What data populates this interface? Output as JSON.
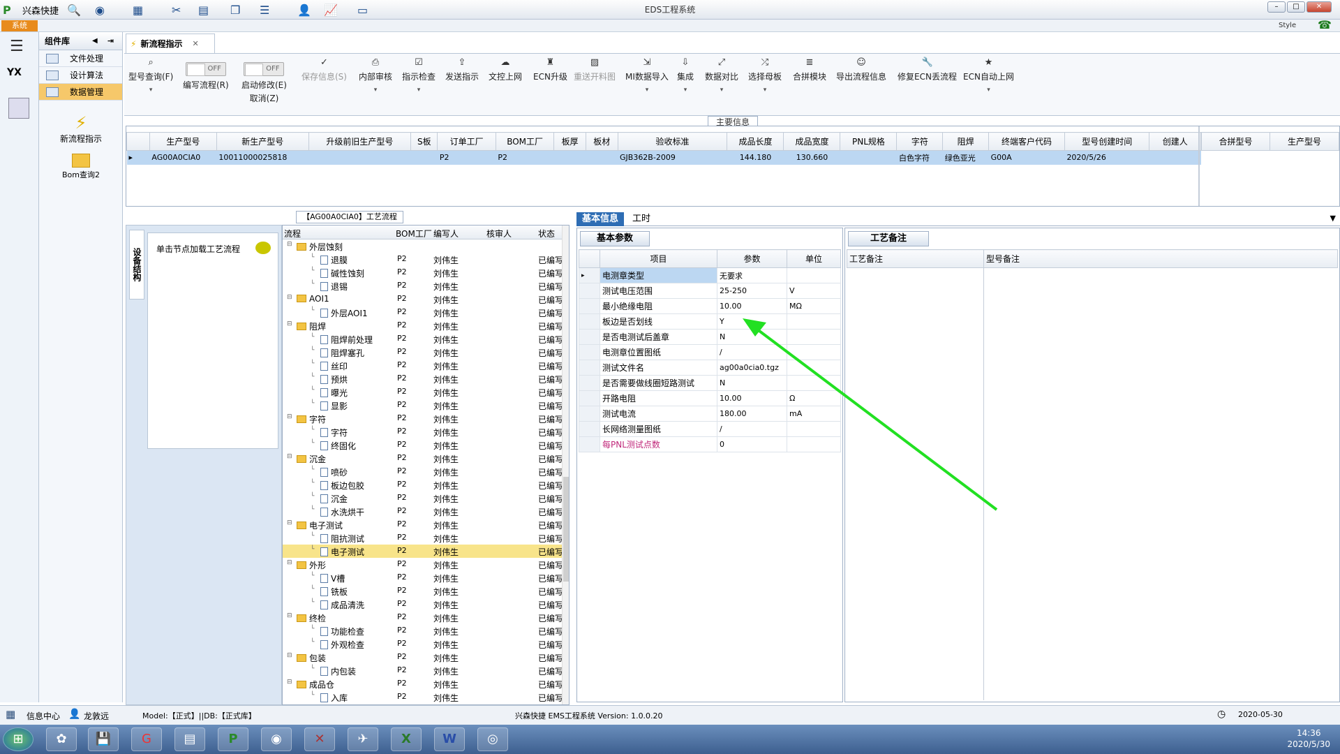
{
  "titlebar": {
    "app_name": "兴森快捷",
    "title": "EDS工程系统"
  },
  "system_tab": "系统",
  "style_label": "Style",
  "nav": {
    "header": "组件库",
    "items": [
      {
        "label": "文件处理"
      },
      {
        "label": "设计算法"
      },
      {
        "label": "数据管理"
      }
    ],
    "big_items": [
      {
        "label": "新流程指示"
      },
      {
        "label": "Bom查询2"
      }
    ]
  },
  "doc_tab": "新流程指示",
  "ribbon": {
    "buttons": [
      {
        "label": "型号查询(F)"
      },
      {
        "label": "编写流程(R)",
        "toggle": "OFF"
      },
      {
        "label": "启动修改(E)",
        "label2": "取消(Z)",
        "toggle": "OFF"
      },
      {
        "label": "保存信息(S)"
      },
      {
        "label": "内部审核"
      },
      {
        "label": "指示检查"
      },
      {
        "label": "发送指示"
      },
      {
        "label": "文控上网"
      },
      {
        "label": "ECN升级"
      },
      {
        "label": "重送开料图"
      },
      {
        "label": "MI数据导入"
      },
      {
        "label": "集成"
      },
      {
        "label": "数据对比"
      },
      {
        "label": "选择母板"
      },
      {
        "label": "合拼模块"
      },
      {
        "label": "导出流程信息"
      },
      {
        "label": "修复ECN丢流程"
      },
      {
        "label": "ECN自动上网"
      }
    ]
  },
  "main_info": {
    "label": "主要信息",
    "columns": [
      "生产型号",
      "新生产型号",
      "升级前旧生产型号",
      "S板",
      "订单工厂",
      "BOM工厂",
      "板厚",
      "板材",
      "验收标准",
      "成品长度",
      "成品宽度",
      "PNL规格",
      "字符",
      "阻焊",
      "终端客户代码",
      "型号创建时间",
      "创建人"
    ],
    "row": [
      "AG00A0CIA0",
      "10011000025818",
      "",
      "",
      "P2",
      "P2",
      "",
      "",
      "GJB362B-2009",
      "144.180",
      "130.660",
      "",
      "白色字符",
      "绿色亚光",
      "G00A",
      "2020/5/26",
      ""
    ],
    "side_columns": [
      "合拼型号",
      "生产型号"
    ]
  },
  "struct": {
    "tab": "设备结构",
    "hint": "单击节点加载工艺流程"
  },
  "flow": {
    "title": "【AG00A0CIA0】工艺流程",
    "columns": [
      "流程",
      "BOM工厂",
      "编写人",
      "核审人",
      "状态"
    ],
    "rows": [
      {
        "name": "外层蚀刻",
        "level": 0,
        "bom": "",
        "writer": "",
        "status": ""
      },
      {
        "name": "退膜",
        "level": 1,
        "bom": "P2",
        "writer": "刘伟生",
        "status": "已编写"
      },
      {
        "name": "碱性蚀刻",
        "level": 1,
        "bom": "P2",
        "writer": "刘伟生",
        "status": "已编写"
      },
      {
        "name": "退锡",
        "level": 1,
        "bom": "P2",
        "writer": "刘伟生",
        "status": "已编写"
      },
      {
        "name": "AOI1",
        "level": 0,
        "bom": "P2",
        "writer": "刘伟生",
        "status": "已编写"
      },
      {
        "name": "外层AOI1",
        "level": 1,
        "bom": "P2",
        "writer": "刘伟生",
        "status": "已编写"
      },
      {
        "name": "阻焊",
        "level": 0,
        "bom": "P2",
        "writer": "刘伟生",
        "status": "已编写"
      },
      {
        "name": "阻焊前处理",
        "level": 1,
        "bom": "P2",
        "writer": "刘伟生",
        "status": "已编写"
      },
      {
        "name": "阻焊塞孔",
        "level": 1,
        "bom": "P2",
        "writer": "刘伟生",
        "status": "已编写"
      },
      {
        "name": "丝印",
        "level": 1,
        "bom": "P2",
        "writer": "刘伟生",
        "status": "已编写"
      },
      {
        "name": "预烘",
        "level": 1,
        "bom": "P2",
        "writer": "刘伟生",
        "status": "已编写"
      },
      {
        "name": "曝光",
        "level": 1,
        "bom": "P2",
        "writer": "刘伟生",
        "status": "已编写"
      },
      {
        "name": "显影",
        "level": 1,
        "bom": "P2",
        "writer": "刘伟生",
        "status": "已编写"
      },
      {
        "name": "字符",
        "level": 0,
        "bom": "P2",
        "writer": "刘伟生",
        "status": "已编写"
      },
      {
        "name": "字符",
        "level": 1,
        "bom": "P2",
        "writer": "刘伟生",
        "status": "已编写"
      },
      {
        "name": "终固化",
        "level": 1,
        "bom": "P2",
        "writer": "刘伟生",
        "status": "已编写"
      },
      {
        "name": "沉金",
        "level": 0,
        "bom": "P2",
        "writer": "刘伟生",
        "status": "已编写"
      },
      {
        "name": "喷砂",
        "level": 1,
        "bom": "P2",
        "writer": "刘伟生",
        "status": "已编写"
      },
      {
        "name": "板边包胶",
        "level": 1,
        "bom": "P2",
        "writer": "刘伟生",
        "status": "已编写"
      },
      {
        "name": "沉金",
        "level": 1,
        "bom": "P2",
        "writer": "刘伟生",
        "status": "已编写"
      },
      {
        "name": "水洗烘干",
        "level": 1,
        "bom": "P2",
        "writer": "刘伟生",
        "status": "已编写"
      },
      {
        "name": "电子测试",
        "level": 0,
        "bom": "P2",
        "writer": "刘伟生",
        "status": "已编写"
      },
      {
        "name": "阻抗测试",
        "level": 1,
        "bom": "P2",
        "writer": "刘伟生",
        "status": "已编写"
      },
      {
        "name": "电子测试",
        "level": 1,
        "bom": "P2",
        "writer": "刘伟生",
        "status": "已编写",
        "hl": true
      },
      {
        "name": "外形",
        "level": 0,
        "bom": "P2",
        "writer": "刘伟生",
        "status": "已编写"
      },
      {
        "name": "V槽",
        "level": 1,
        "bom": "P2",
        "writer": "刘伟生",
        "status": "已编写"
      },
      {
        "name": "铣板",
        "level": 1,
        "bom": "P2",
        "writer": "刘伟生",
        "status": "已编写"
      },
      {
        "name": "成品清洗",
        "level": 1,
        "bom": "P2",
        "writer": "刘伟生",
        "status": "已编写"
      },
      {
        "name": "终检",
        "level": 0,
        "bom": "P2",
        "writer": "刘伟生",
        "status": "已编写"
      },
      {
        "name": "功能检查",
        "level": 1,
        "bom": "P2",
        "writer": "刘伟生",
        "status": "已编写"
      },
      {
        "name": "外观检查",
        "level": 1,
        "bom": "P2",
        "writer": "刘伟生",
        "status": "已编写"
      },
      {
        "name": "包装",
        "level": 0,
        "bom": "P2",
        "writer": "刘伟生",
        "status": "已编写"
      },
      {
        "name": "内包装",
        "level": 1,
        "bom": "P2",
        "writer": "刘伟生",
        "status": "已编写"
      },
      {
        "name": "成品仓",
        "level": 0,
        "bom": "P2",
        "writer": "刘伟生",
        "status": "已编写"
      },
      {
        "name": "入库",
        "level": 1,
        "bom": "P2",
        "writer": "刘伟生",
        "status": "已编写"
      }
    ]
  },
  "right_tabs": [
    "基本信息",
    "工时"
  ],
  "basic": {
    "tab": "基本参数",
    "columns": [
      "项目",
      "参数",
      "单位"
    ],
    "rows": [
      {
        "item": "电测章类型",
        "value": "无要求",
        "unit": "",
        "sel": true
      },
      {
        "item": "测试电压范围",
        "value": "25-250",
        "unit": "V"
      },
      {
        "item": "最小绝缘电阻",
        "value": "10.00",
        "unit": "MΩ"
      },
      {
        "item": "板边是否划线",
        "value": "Y",
        "unit": ""
      },
      {
        "item": "是否电测试后盖章",
        "value": "N",
        "unit": ""
      },
      {
        "item": "电测章位置图纸",
        "value": "/",
        "unit": ""
      },
      {
        "item": "测试文件名",
        "value": "ag00a0cia0.tgz",
        "unit": ""
      },
      {
        "item": "是否需要做线圈短路测试",
        "value": "N",
        "unit": ""
      },
      {
        "item": "开路电阻",
        "value": "10.00",
        "unit": "Ω"
      },
      {
        "item": "测试电流",
        "value": "180.00",
        "unit": "mA"
      },
      {
        "item": "长网络测量图纸",
        "value": "/",
        "unit": ""
      },
      {
        "item": "每PNL测试点数",
        "value": "0",
        "unit": "",
        "highlight": true
      }
    ]
  },
  "proc": {
    "tab": "工艺备注",
    "columns": [
      "工艺备注",
      "型号备注"
    ]
  },
  "status": {
    "info_center": "信息中心",
    "user": "龙敦远",
    "model": "Model:【正式】||DB:【正式库】",
    "center": "兴森快捷 EMS工程系统 Version: 1.0.0.20",
    "date": "2020-05-30"
  },
  "clock": {
    "time": "14:36",
    "date": "2020/5/30"
  },
  "colors": {
    "accent": "#2e6db4",
    "selection": "#bcd7f2",
    "system_tab": "#e88b1c",
    "arrow": "#22e022"
  }
}
